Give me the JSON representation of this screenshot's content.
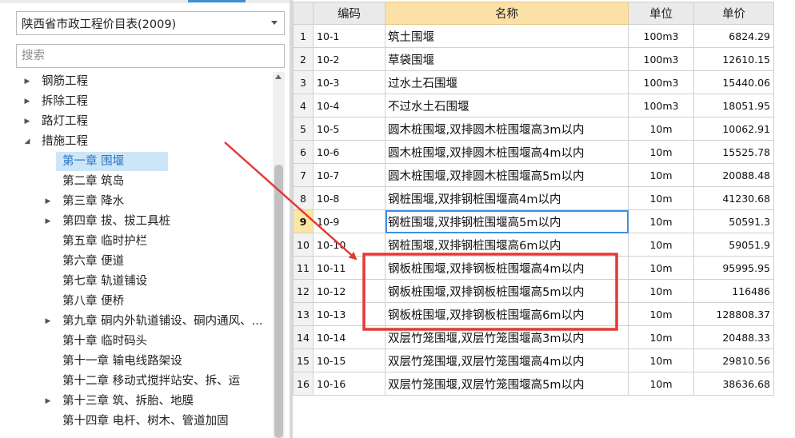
{
  "library_select": {
    "value": "陕西省市政工程价目表(2009)"
  },
  "search": {
    "placeholder": "搜索"
  },
  "tree": [
    {
      "label": "钢筋工程",
      "level": 0,
      "expanded": false,
      "has_children": true
    },
    {
      "label": "拆除工程",
      "level": 0,
      "expanded": false,
      "has_children": true
    },
    {
      "label": "路灯工程",
      "level": 0,
      "expanded": false,
      "has_children": true
    },
    {
      "label": "措施工程",
      "level": 0,
      "expanded": true,
      "has_children": true
    },
    {
      "label": "第一章 围堰",
      "level": 1,
      "has_children": false,
      "selected": true
    },
    {
      "label": "第二章 筑岛",
      "level": 1,
      "has_children": false
    },
    {
      "label": "第三章 降水",
      "level": 1,
      "has_children": true
    },
    {
      "label": "第四章 拔、拔工具桩",
      "level": 1,
      "has_children": true
    },
    {
      "label": "第五章 临时护栏",
      "level": 1,
      "has_children": false
    },
    {
      "label": "第六章 便道",
      "level": 1,
      "has_children": false
    },
    {
      "label": "第七章 轨道铺设",
      "level": 1,
      "has_children": false
    },
    {
      "label": "第八章 便桥",
      "level": 1,
      "has_children": false
    },
    {
      "label": "第九章 硐内外轨道铺设、硐内通风、...",
      "level": 1,
      "has_children": true
    },
    {
      "label": "第十章 临时码头",
      "level": 1,
      "has_children": false
    },
    {
      "label": "第十一章 输电线路架设",
      "level": 1,
      "has_children": false
    },
    {
      "label": "第十二章 移动式搅拌站安、拆、运",
      "level": 1,
      "has_children": false
    },
    {
      "label": "第十三章 筑、拆胎、地膜",
      "level": 1,
      "has_children": true
    },
    {
      "label": "第十四章 电杆、树木、管道加固",
      "level": 1,
      "has_children": false
    }
  ],
  "grid": {
    "headers": {
      "rownum": "",
      "code": "编码",
      "name": "名称",
      "unit": "单位",
      "price": "单价"
    },
    "current_row": 9,
    "rows": [
      {
        "no": "1",
        "code": "10-1",
        "name": "筑土围堰",
        "unit": "100m3",
        "price": "6824.29"
      },
      {
        "no": "2",
        "code": "10-2",
        "name": "草袋围堰",
        "unit": "100m3",
        "price": "12610.15"
      },
      {
        "no": "3",
        "code": "10-3",
        "name": "过水土石围堰",
        "unit": "100m3",
        "price": "15440.06"
      },
      {
        "no": "4",
        "code": "10-4",
        "name": "不过水土石围堰",
        "unit": "100m3",
        "price": "18051.95"
      },
      {
        "no": "5",
        "code": "10-5",
        "name": "圆木桩围堰,双排圆木桩围堰高3m以内",
        "unit": "10m",
        "price": "10062.91"
      },
      {
        "no": "6",
        "code": "10-6",
        "name": "圆木桩围堰,双排圆木桩围堰高4m以内",
        "unit": "10m",
        "price": "15525.78"
      },
      {
        "no": "7",
        "code": "10-7",
        "name": "圆木桩围堰,双排圆木桩围堰高5m以内",
        "unit": "10m",
        "price": "20088.48"
      },
      {
        "no": "8",
        "code": "10-8",
        "name": "钢桩围堰,双排钢桩围堰高4m以内",
        "unit": "10m",
        "price": "41230.68"
      },
      {
        "no": "9",
        "code": "10-9",
        "name": "钢桩围堰,双排钢桩围堰高5m以内",
        "unit": "10m",
        "price": "50591.3"
      },
      {
        "no": "10",
        "code": "10-10",
        "name": "钢桩围堰,双排钢桩围堰高6m以内",
        "unit": "10m",
        "price": "59051.9"
      },
      {
        "no": "11",
        "code": "10-11",
        "name": "钢板桩围堰,双排钢板桩围堰高4m以内",
        "unit": "10m",
        "price": "95995.95"
      },
      {
        "no": "12",
        "code": "10-12",
        "name": "钢板桩围堰,双排钢板桩围堰高5m以内",
        "unit": "10m",
        "price": "116486"
      },
      {
        "no": "13",
        "code": "10-13",
        "name": "钢板桩围堰,双排钢板桩围堰高6m以内",
        "unit": "10m",
        "price": "128808.37"
      },
      {
        "no": "14",
        "code": "10-14",
        "name": "双层竹笼围堰,双层竹笼围堰高3m以内",
        "unit": "10m",
        "price": "20488.33"
      },
      {
        "no": "15",
        "code": "10-15",
        "name": "双层竹笼围堰,双层竹笼围堰高4m以内",
        "unit": "10m",
        "price": "29810.56"
      },
      {
        "no": "16",
        "code": "10-16",
        "name": "双层竹笼围堰,双层竹笼围堰高5m以内",
        "unit": "10m",
        "price": "38636.68"
      }
    ]
  },
  "annotations": {
    "color": "#e53935",
    "highlight_rows": [
      11,
      12,
      13
    ]
  }
}
